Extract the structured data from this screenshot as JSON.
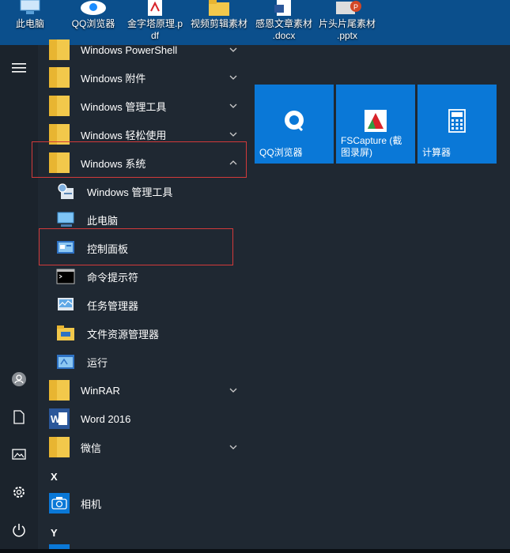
{
  "desktop": {
    "icons": [
      {
        "label": "此电脑"
      },
      {
        "label": "QQ浏览器"
      },
      {
        "label": "金字塔原理.p\ndf"
      },
      {
        "label": "视频剪辑素材"
      },
      {
        "label": "感恩文章素材\n.docx"
      },
      {
        "label": "片头片尾素材\n.pptx"
      }
    ]
  },
  "rail": {
    "items": [
      {
        "icon": "hamburger-menu-icon"
      },
      {
        "icon": "user-avatar-icon"
      },
      {
        "icon": "document-icon"
      },
      {
        "icon": "pictures-icon"
      },
      {
        "icon": "settings-gear-icon"
      },
      {
        "icon": "power-icon"
      }
    ]
  },
  "apps": {
    "items": [
      {
        "label": "Windows PowerShell",
        "icon": "folder-icon",
        "chevron": "down"
      },
      {
        "label": "Windows 附件",
        "icon": "folder-icon",
        "chevron": "down"
      },
      {
        "label": "Windows 管理工具",
        "icon": "folder-icon",
        "chevron": "down"
      },
      {
        "label": "Windows 轻松使用",
        "icon": "folder-icon",
        "chevron": "down"
      },
      {
        "label": "Windows 系统",
        "icon": "folder-icon",
        "chevron": "up"
      },
      {
        "label": "Windows 管理工具",
        "icon": "admin-tools-icon"
      },
      {
        "label": "此电脑",
        "icon": "this-pc-icon"
      },
      {
        "label": "控制面板",
        "icon": "control-panel-icon"
      },
      {
        "label": "命令提示符",
        "icon": "command-prompt-icon"
      },
      {
        "label": "任务管理器",
        "icon": "task-manager-icon"
      },
      {
        "label": "文件资源管理器",
        "icon": "file-explorer-icon"
      },
      {
        "label": "运行",
        "icon": "run-icon"
      },
      {
        "label": "WinRAR",
        "icon": "folder-icon",
        "chevron": "down"
      },
      {
        "label": "Word 2016",
        "icon": "word-icon"
      },
      {
        "label": "微信",
        "icon": "folder-icon",
        "chevron": "down"
      },
      {
        "label": "相机",
        "icon": "camera-icon"
      }
    ],
    "letters": [
      "X",
      "Y"
    ]
  },
  "tiles": [
    {
      "label": "QQ浏览器",
      "icon": "qq-browser-icon"
    },
    {
      "label": "FSCapture (截\n图录屏)",
      "icon": "fscapture-icon"
    },
    {
      "label": "计算器",
      "icon": "calculator-icon"
    }
  ],
  "colors": {
    "accent": "#0a78d7",
    "highlight_border": "#d33a3a",
    "folder": "#f2c84b"
  }
}
